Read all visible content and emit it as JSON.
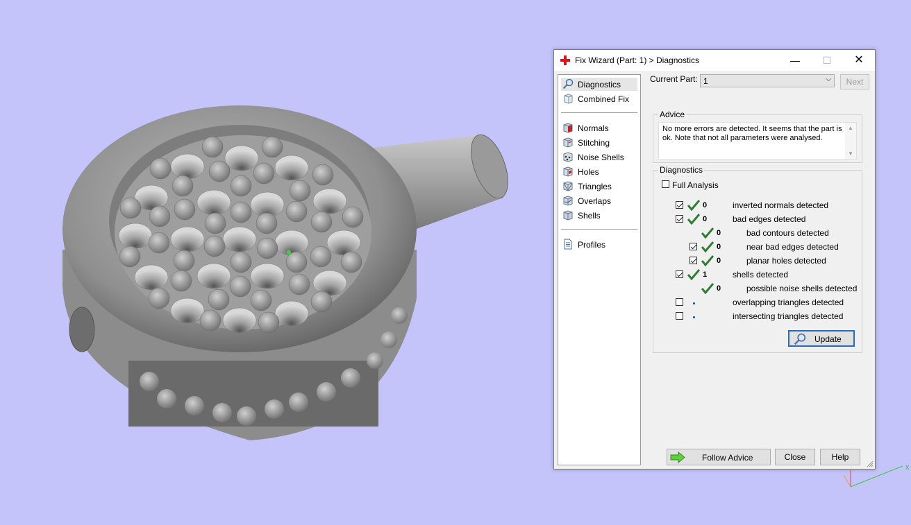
{
  "dialog": {
    "title": "Fix Wizard (Part: 1) > Diagnostics",
    "window_buttons": {
      "minimize": "—",
      "maximize": "☐",
      "close": "✕"
    }
  },
  "nav": {
    "top": [
      {
        "label": "Diagnostics",
        "icon": "magnifier-icon",
        "selected": true
      },
      {
        "label": "Combined Fix",
        "icon": "cube-icon"
      }
    ],
    "tools": [
      {
        "label": "Normals",
        "icon": "normals-cube-icon"
      },
      {
        "label": "Stitching",
        "icon": "stitching-cube-icon"
      },
      {
        "label": "Noise Shells",
        "icon": "noise-shells-icon"
      },
      {
        "label": "Holes",
        "icon": "holes-cube-icon"
      },
      {
        "label": "Triangles",
        "icon": "triangles-cube-icon"
      },
      {
        "label": "Overlaps",
        "icon": "overlaps-cube-icon"
      },
      {
        "label": "Shells",
        "icon": "shells-cube-icon"
      }
    ],
    "bottom": [
      {
        "label": "Profiles",
        "icon": "document-icon"
      }
    ]
  },
  "current_part": {
    "label": "Current Part:",
    "value": "1",
    "next_label": "Next"
  },
  "advice": {
    "title": "Advice",
    "text": "No more errors are detected. It seems that the part is ok. Note that not all parameters were analysed."
  },
  "diagnostics": {
    "title": "Diagnostics",
    "full_analysis_label": "Full Analysis",
    "full_analysis_checked": false,
    "rows": [
      {
        "checkbox": true,
        "checked": true,
        "status": "ok",
        "count": "0",
        "label": "inverted normals detected",
        "indent": 0
      },
      {
        "checkbox": true,
        "checked": true,
        "status": "ok",
        "count": "0",
        "label": "bad edges detected",
        "indent": 0
      },
      {
        "checkbox": false,
        "checked": false,
        "status": "ok",
        "count": "0",
        "label": "bad contours detected",
        "indent": 1
      },
      {
        "checkbox": true,
        "checked": true,
        "status": "ok",
        "count": "0",
        "label": "near bad edges detected",
        "indent": 1
      },
      {
        "checkbox": true,
        "checked": true,
        "status": "ok",
        "count": "0",
        "label": "planar holes detected",
        "indent": 1
      },
      {
        "checkbox": true,
        "checked": true,
        "status": "ok",
        "count": "1",
        "label": "shells detected",
        "indent": 0
      },
      {
        "checkbox": false,
        "checked": false,
        "status": "ok",
        "count": "0",
        "label": "possible noise shells detected",
        "indent": 1
      },
      {
        "checkbox": true,
        "checked": false,
        "status": "pending",
        "count": "",
        "label": "overlapping triangles detected",
        "indent": 0
      },
      {
        "checkbox": true,
        "checked": false,
        "status": "pending",
        "count": "",
        "label": "intersecting triangles detected",
        "indent": 0
      }
    ],
    "update_label": "Update"
  },
  "footer": {
    "follow_advice": "Follow Advice",
    "close": "Close",
    "help": "Help"
  },
  "colors": {
    "viewport_bg": "#c4c4fa",
    "tick_green": "#2e7d32",
    "title_icon_red": "#d9141e"
  }
}
